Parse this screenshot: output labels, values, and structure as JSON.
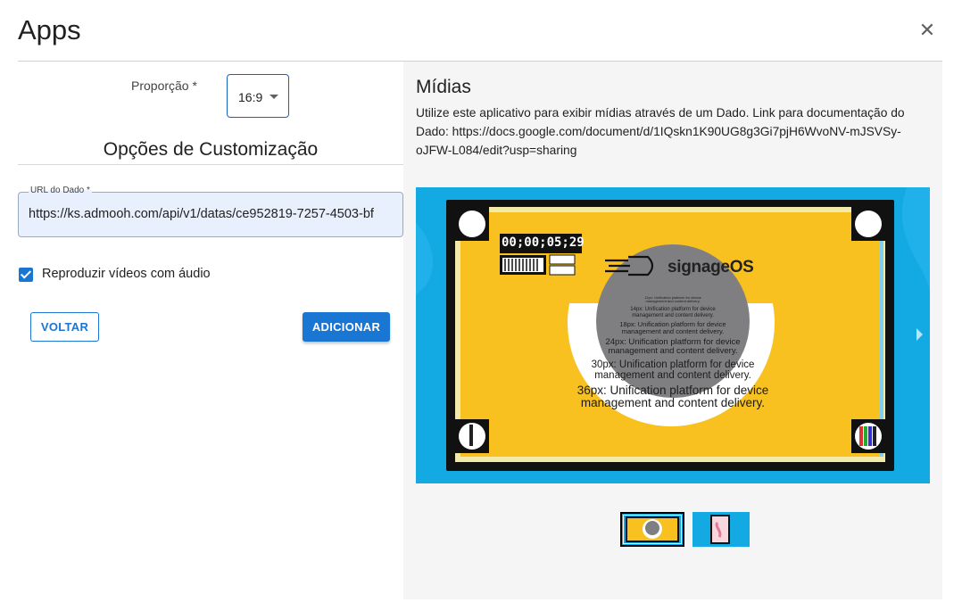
{
  "dialog": {
    "title": "Apps",
    "close_icon": "close-icon"
  },
  "left": {
    "proportion_label": "Proporção *",
    "proportion_value": "16:9",
    "customization_title": "Opções de Customização",
    "url_label": "URL do Dado *",
    "url_value": "https://ks.admooh.com/api/v1/datas/ce952819-7257-4503-bf",
    "checkbox_label": "Reproduzir vídeos com áudio",
    "checkbox_checked": true,
    "back_label": "VOLTAR",
    "add_label": "ADICIONAR"
  },
  "right": {
    "title": "Mídias",
    "description": "Utilize este aplicativo para exibir mídias através de um Dado. Link para documentação do Dado: https://docs.google.com/document/d/1IQskn1K90UG8g3Gi7pjH6WvoNV-mJSVSy-oJFW-L084/edit?usp=sharing",
    "preview": {
      "timecode": "00;00;05;29",
      "brand": "signageOS",
      "lines": [
        "12px: Unification platform for device management and content delivery.",
        "14px: Unification platform for device",
        "management and content delivery.",
        "18px: Unification platform for device",
        "management and content delivery.",
        "24px: Unification platform for device",
        "management and content delivery.",
        "30px: Unification platform for device",
        "management and content delivery.",
        "36px: Unification platform for device",
        "management and content delivery."
      ]
    },
    "thumbnails": [
      "thumbnail-1",
      "thumbnail-2"
    ]
  },
  "colors": {
    "primary": "#1976d2",
    "preview_bg": "#13a9e3",
    "screen_yellow": "#f8c11f",
    "panel_bg": "#f5f5f5",
    "input_bg": "#e8f0fe"
  }
}
